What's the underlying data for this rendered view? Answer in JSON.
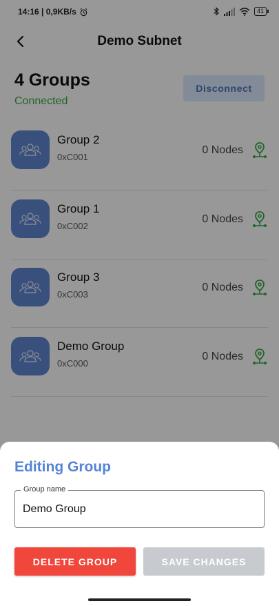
{
  "status_bar": {
    "time_info": "14:16 | 0,9KB/s",
    "battery": "41"
  },
  "app_bar": {
    "title": "Demo Subnet"
  },
  "header": {
    "groups_count": "4 Groups",
    "connection_status": "Connected",
    "disconnect_label": "Disconnect"
  },
  "groups": [
    {
      "name": "Group 2",
      "address": "0xC001",
      "nodes": "0 Nodes"
    },
    {
      "name": "Group 1",
      "address": "0xC002",
      "nodes": "0 Nodes"
    },
    {
      "name": "Group 3",
      "address": "0xC003",
      "nodes": "0 Nodes"
    },
    {
      "name": "Demo Group",
      "address": "0xC000",
      "nodes": "0 Nodes"
    }
  ],
  "sheet": {
    "title": "Editing Group",
    "field_label": "Group name",
    "field_value": "Demo Group",
    "delete_label": "DELETE GROUP",
    "save_label": "SAVE CHANGES"
  },
  "colors": {
    "accent_blue": "#5584d6",
    "avatar_blue": "#5d80c9",
    "connected_green": "#35a343",
    "delete_red": "#f0463c",
    "save_disabled": "#c7cbcf"
  },
  "icons": {
    "back": "arrow-back-icon",
    "group": "people-group-icon",
    "node_pin": "location-pin-icon",
    "bluetooth": "bluetooth-icon",
    "signal": "signal-icon",
    "wifi": "wifi-icon",
    "alarm": "alarm-clock-icon"
  }
}
